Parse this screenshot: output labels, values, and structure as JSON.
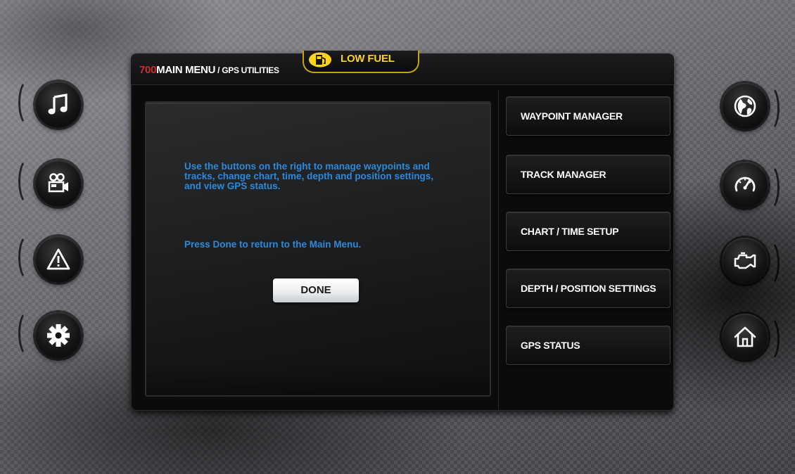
{
  "header": {
    "prefix": "700",
    "title": "MAIN MENU",
    "subtitle": " / GPS UTILITIES"
  },
  "alert": {
    "label": "LOW FUEL",
    "icon": "fuel-pump-icon",
    "color": "#ffd21a"
  },
  "content": {
    "intro": "Use the buttons on the right to manage waypoints and tracks, change chart, time, depth and position settings, and  view GPS status.",
    "done_hint": "Press Done to return to the Main Menu.",
    "done_label": "DONE",
    "text_color": "#2a8bdc"
  },
  "menu": {
    "items": [
      {
        "label": "WAYPOINT MANAGER"
      },
      {
        "label": "TRACK MANAGER"
      },
      {
        "label": "CHART / TIME SETUP"
      },
      {
        "label": "DEPTH / POSITION SETTINGS"
      },
      {
        "label": "GPS STATUS"
      }
    ]
  },
  "left_buttons": [
    "music-note-icon",
    "video-camera-icon",
    "warning-icon",
    "settings-gear-icon"
  ],
  "right_buttons": [
    "globe-icon",
    "speedometer-icon",
    "engine-icon",
    "home-icon"
  ]
}
